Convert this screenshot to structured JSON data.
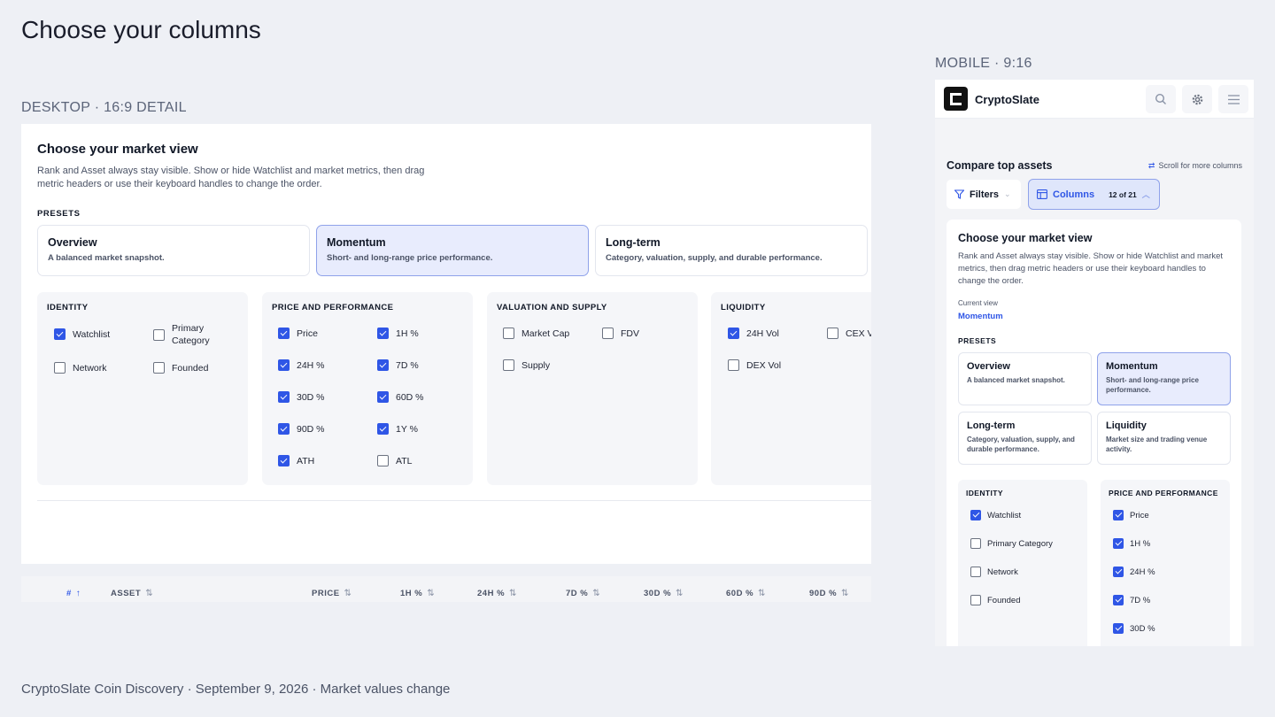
{
  "page_title": "Choose your columns",
  "labels": {
    "desktop": "DESKTOP · 16:9 DETAIL",
    "mobile": "MOBILE · 9:16"
  },
  "footer": "CryptoSlate Coin Discovery · September 9, 2026 · Market values change",
  "desktop": {
    "title": "Choose your market view",
    "description": "Rank and Asset always stay visible. Show or hide Watchlist and market metrics, then drag metric headers or use their keyboard handles to change the order.",
    "presets_heading": "PRESETS",
    "presets": [
      {
        "name": "Overview",
        "desc": "A balanced market snapshot.",
        "active": false
      },
      {
        "name": "Momentum",
        "desc": "Short- and long-range price performance.",
        "active": true
      },
      {
        "name": "Long-term",
        "desc": "Category, valuation, supply, and durable performance.",
        "active": false
      }
    ],
    "groups": {
      "identity": {
        "heading": "IDENTITY",
        "options": [
          {
            "label": "Watchlist",
            "checked": true
          },
          {
            "label": "Primary Category",
            "checked": false
          },
          {
            "label": "Network",
            "checked": false
          },
          {
            "label": "Founded",
            "checked": false
          }
        ]
      },
      "price": {
        "heading": "PRICE AND PERFORMANCE",
        "options": [
          {
            "label": "Price",
            "checked": true
          },
          {
            "label": "1H %",
            "checked": true
          },
          {
            "label": "24H %",
            "checked": true
          },
          {
            "label": "7D %",
            "checked": true
          },
          {
            "label": "30D %",
            "checked": true
          },
          {
            "label": "60D %",
            "checked": true
          },
          {
            "label": "90D %",
            "checked": true
          },
          {
            "label": "1Y %",
            "checked": true
          },
          {
            "label": "ATH",
            "checked": true
          },
          {
            "label": "ATL",
            "checked": false
          }
        ]
      },
      "valuation": {
        "heading": "VALUATION AND SUPPLY",
        "options": [
          {
            "label": "Market Cap",
            "checked": false
          },
          {
            "label": "FDV",
            "checked": false
          },
          {
            "label": "Supply",
            "checked": false
          }
        ]
      },
      "liquidity": {
        "heading": "LIQUIDITY",
        "options": [
          {
            "label": "24H Vol",
            "checked": true
          },
          {
            "label": "CEX V",
            "checked": false
          },
          {
            "label": "DEX Vol",
            "checked": false
          }
        ]
      }
    },
    "table_headers": [
      "#",
      "ASSET",
      "PRICE",
      "1H %",
      "24H %",
      "7D %",
      "30D %",
      "60D %",
      "90D %"
    ]
  },
  "mobile": {
    "brand": "CryptoSlate",
    "compare_title": "Compare top assets",
    "scroll_hint": "Scroll for more columns",
    "filters_label": "Filters",
    "columns_label": "Columns",
    "columns_count": "12 of 21",
    "card_title": "Choose your market view",
    "card_desc": "Rank and Asset always stay visible. Show or hide Watchlist and market metrics, then drag metric headers or use their keyboard handles to change the order.",
    "current_view_label": "Current view",
    "current_view_value": "Momentum",
    "presets_heading": "PRESETS",
    "presets": [
      {
        "name": "Overview",
        "desc": "A balanced market snapshot.",
        "active": false
      },
      {
        "name": "Momentum",
        "desc": "Short- and long-range price performance.",
        "active": true
      },
      {
        "name": "Long-term",
        "desc": "Category, valuation, supply, and durable performance.",
        "active": false
      },
      {
        "name": "Liquidity",
        "desc": "Market size and trading venue activity.",
        "active": false
      }
    ],
    "identity": {
      "heading": "IDENTITY",
      "options": [
        {
          "label": "Watchlist",
          "checked": true
        },
        {
          "label": "Primary Category",
          "checked": false
        },
        {
          "label": "Network",
          "checked": false
        },
        {
          "label": "Founded",
          "checked": false
        }
      ]
    },
    "price": {
      "heading": "PRICE AND PERFORMANCE",
      "options": [
        {
          "label": "Price",
          "checked": true
        },
        {
          "label": "1H %",
          "checked": true
        },
        {
          "label": "24H %",
          "checked": true
        },
        {
          "label": "7D %",
          "checked": true
        },
        {
          "label": "30D %",
          "checked": true
        }
      ]
    }
  }
}
